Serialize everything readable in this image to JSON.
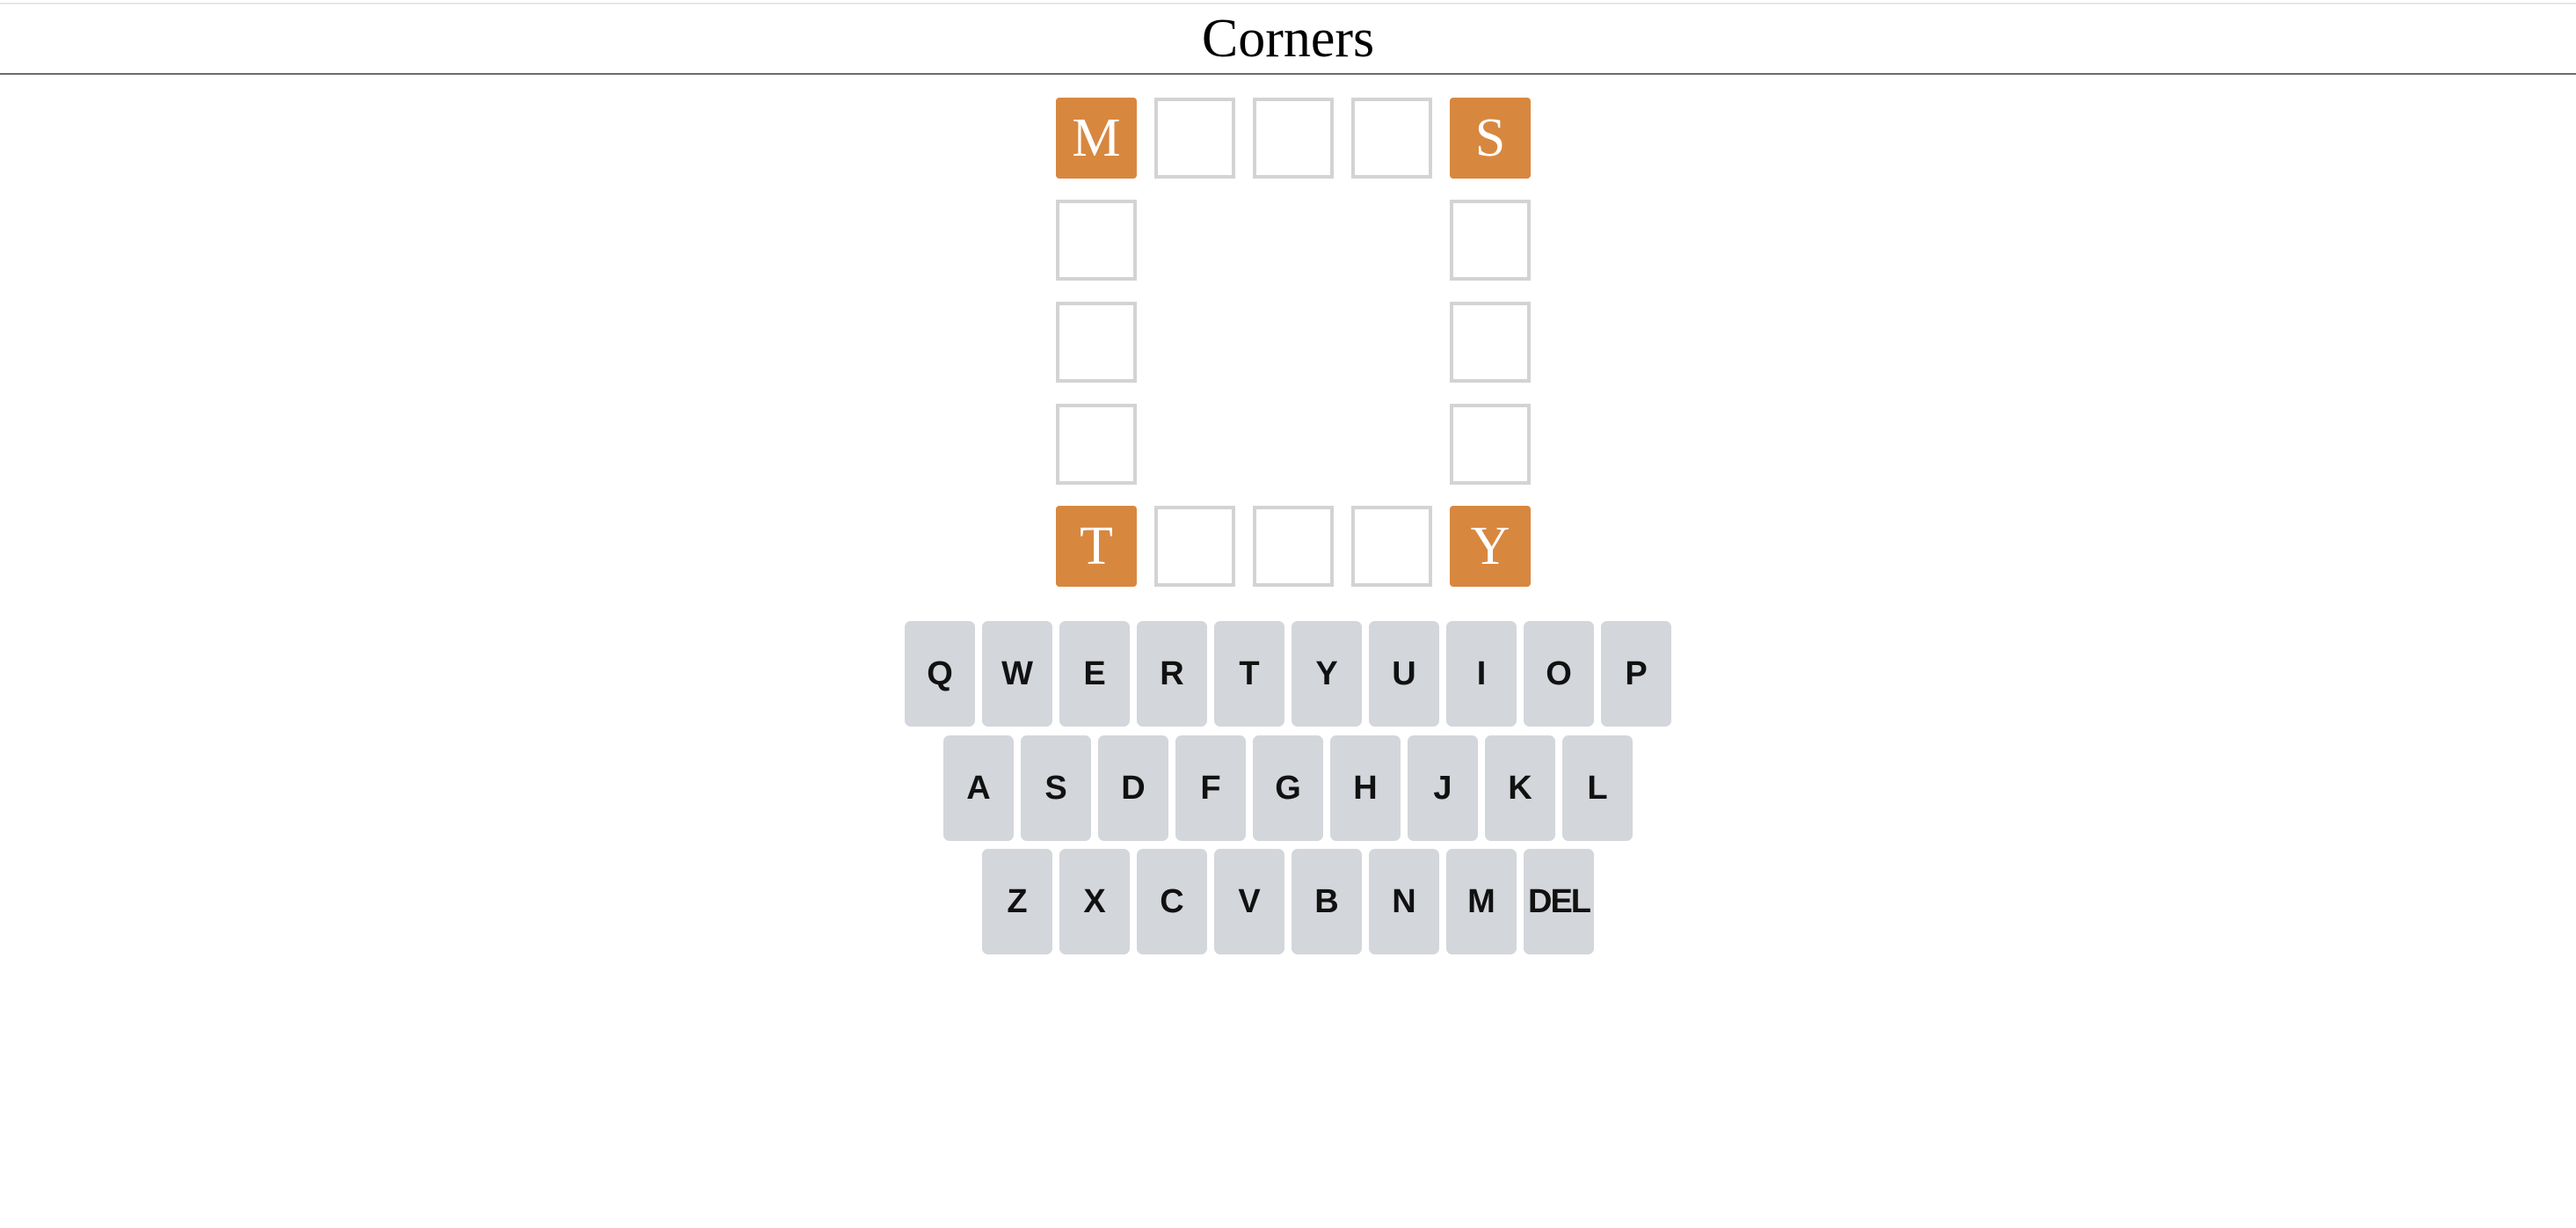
{
  "game": {
    "title": "Corners"
  },
  "board": {
    "corner_color": "#d8873f",
    "empty_border_color": "#d3d3d3",
    "tiles": {
      "top": [
        "M",
        "",
        "",
        "",
        "S"
      ],
      "left": [
        "",
        "",
        ""
      ],
      "right": [
        "",
        "",
        ""
      ],
      "bottom": [
        "T",
        "",
        "",
        "",
        "Y"
      ]
    }
  },
  "keyboard": {
    "key_color": "#d3d6da",
    "rows": [
      [
        "Q",
        "W",
        "E",
        "R",
        "T",
        "Y",
        "U",
        "I",
        "O",
        "P"
      ],
      [
        "A",
        "S",
        "D",
        "F",
        "G",
        "H",
        "J",
        "K",
        "L"
      ],
      [
        "Z",
        "X",
        "C",
        "V",
        "B",
        "N",
        "M",
        "DEL"
      ]
    ]
  }
}
